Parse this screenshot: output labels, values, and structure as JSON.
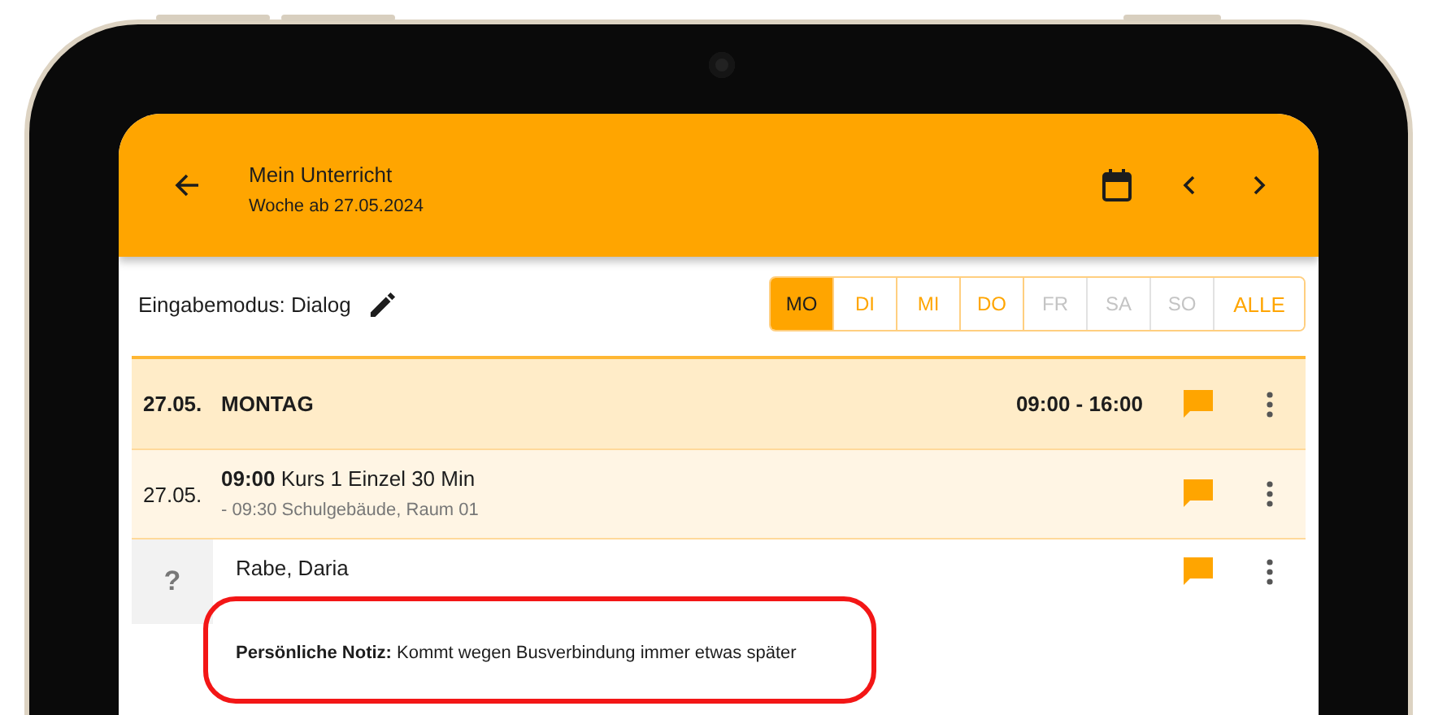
{
  "app_bar": {
    "title": "Mein Unterricht",
    "subtitle": "Woche ab 27.05.2024"
  },
  "input_mode": {
    "label": "Eingabemodus: Dialog"
  },
  "day_filter": [
    {
      "label": "MO",
      "selected": true,
      "disabled": false
    },
    {
      "label": "DI",
      "selected": false,
      "disabled": false
    },
    {
      "label": "MI",
      "selected": false,
      "disabled": false
    },
    {
      "label": "DO",
      "selected": false,
      "disabled": false
    },
    {
      "label": "FR",
      "selected": false,
      "disabled": true
    },
    {
      "label": "SA",
      "selected": false,
      "disabled": true
    },
    {
      "label": "SO",
      "selected": false,
      "disabled": true
    }
  ],
  "all_button": {
    "label": "ALLE"
  },
  "day_header": {
    "date": "27.05.",
    "weekday": "MONTAG",
    "hours": "09:00 - 16:00"
  },
  "lesson": {
    "date": "27.05.",
    "title": "**09:00** Kurs 1 Einzel 30 Min",
    "details": "- 09:30 Schulgebäude, Raum 01"
  },
  "student": {
    "avatar": "?",
    "name": "Rabe, Daria",
    "note": "**Persönliche Notiz:** Kommt wegen Busverbindung immer etwas später",
    "highlighted": true
  }
}
